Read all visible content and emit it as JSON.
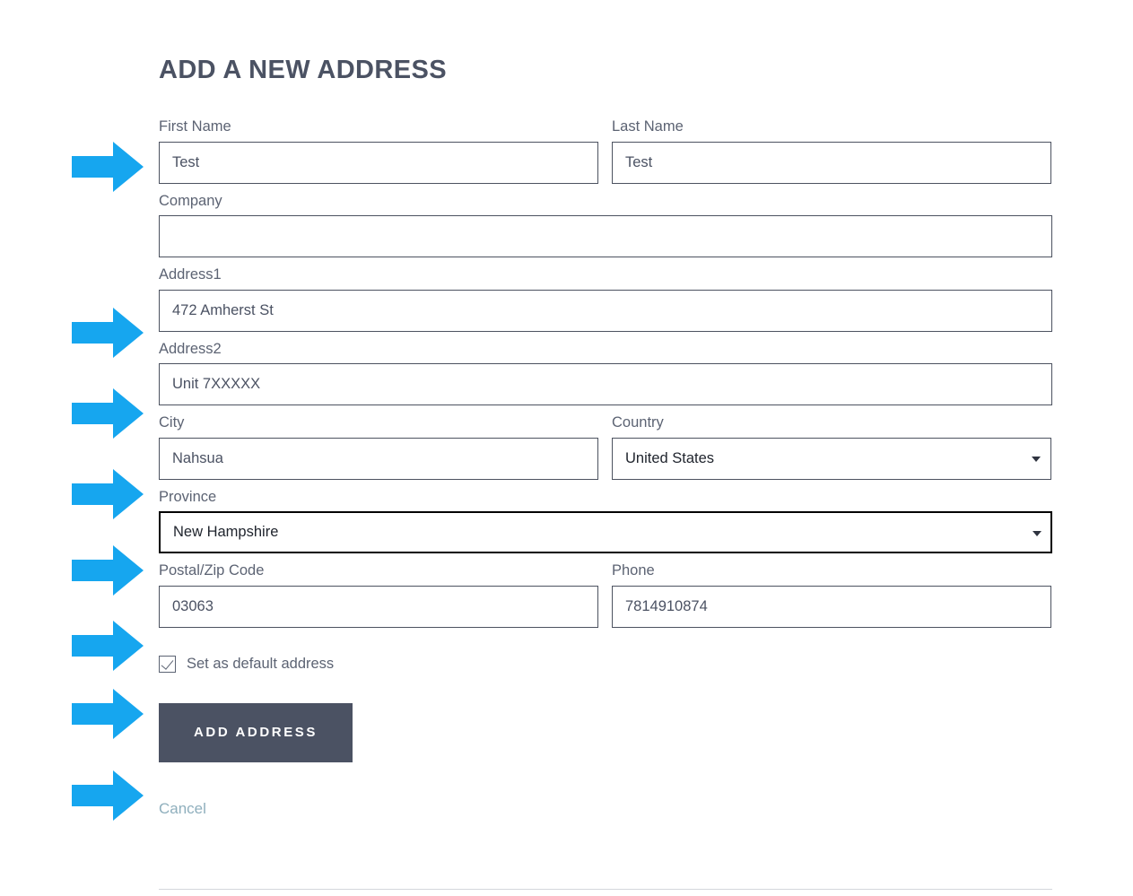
{
  "page": {
    "title": "ADD A NEW ADDRESS",
    "accent_arrow_color": "#16a6ef",
    "title_color": "#4b5263",
    "button_color": "#4b5263",
    "cancel_color": "#8fafbd"
  },
  "form": {
    "fields": {
      "first_name": {
        "label": "First Name",
        "value": "Test"
      },
      "last_name": {
        "label": "Last Name",
        "value": "Test"
      },
      "company": {
        "label": "Company",
        "value": ""
      },
      "address1": {
        "label": "Address1",
        "value": "472 Amherst St"
      },
      "address2": {
        "label": "Address2",
        "value": "Unit 7XXXXX"
      },
      "city": {
        "label": "City",
        "value": "Nahsua"
      },
      "country": {
        "label": "Country",
        "value": "United States"
      },
      "province": {
        "label": "Province",
        "value": "New Hampshire"
      },
      "postal_code": {
        "label": "Postal/Zip Code",
        "value": "03063"
      },
      "phone": {
        "label": "Phone",
        "value": "7814910874"
      }
    },
    "default_address": {
      "label": "Set as default address",
      "checked": "true"
    },
    "submit_label": "ADD ADDRESS",
    "cancel_label": "Cancel"
  },
  "annotations": {
    "arrows": [
      {
        "name": "arrow-first-name",
        "target": "first-name-input"
      },
      {
        "name": "arrow-address1",
        "target": "address1-input"
      },
      {
        "name": "arrow-address2",
        "target": "address2-input"
      },
      {
        "name": "arrow-city",
        "target": "city-input"
      },
      {
        "name": "arrow-province",
        "target": "province-select"
      },
      {
        "name": "arrow-postal-code",
        "target": "postal-code-input"
      },
      {
        "name": "arrow-default-checkbox",
        "target": "default-address-checkbox"
      },
      {
        "name": "arrow-add-address",
        "target": "add-address-button"
      }
    ]
  }
}
